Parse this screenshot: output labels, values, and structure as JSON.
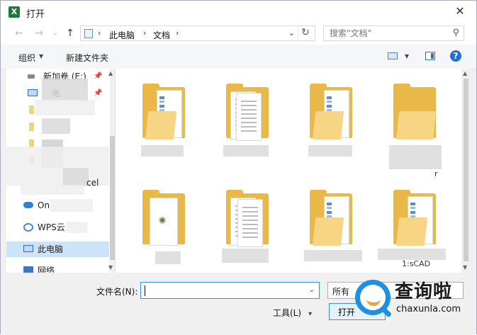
{
  "window": {
    "title": "打开",
    "app_icon_letter": "X",
    "close_glyph": "✕"
  },
  "nav": {
    "back_glyph": "←",
    "forward_glyph": "→",
    "dropdown_glyph": "⌄",
    "up_glyph": "↑"
  },
  "address": {
    "crumbs": [
      "此电脑",
      "文档"
    ],
    "separator": "›",
    "dropdown_glyph": "⌄",
    "refresh_glyph": "↻"
  },
  "search": {
    "placeholder": "搜索\"文档\"",
    "icon": "search-icon",
    "glyph": "⚲"
  },
  "toolbar": {
    "organize_label": "组织",
    "new_folder_label": "新建文件夹",
    "help_glyph": "?",
    "dropdown_glyph": "▾"
  },
  "sidebar": {
    "items": [
      {
        "label": "新加卷 (E:)",
        "icon": "drive-icon"
      },
      {
        "label": "电",
        "icon": "folder-icon"
      },
      {
        "label": "cel",
        "icon": "folder-icon"
      },
      {
        "label": "On",
        "icon": "onedrive-icon"
      },
      {
        "label": "WPS云",
        "icon": "wps-cloud-icon"
      },
      {
        "label": "此电脑",
        "icon": "pc-icon"
      },
      {
        "label": "网络",
        "icon": "network-icon"
      }
    ],
    "pin_glyph": "📌"
  },
  "content": {
    "partial_labels": [
      "r",
      "1:sCAD"
    ]
  },
  "filename": {
    "label": "文件名(N):",
    "value": ""
  },
  "filetype": {
    "label": "所有"
  },
  "tools": {
    "label": "工具(L)"
  },
  "open_button": {
    "label": "打开"
  },
  "watermark": {
    "brand": "查询啦",
    "site": "chaxunla.com"
  },
  "colors": {
    "accent": "#1f6fd0",
    "folder": "#e8b949",
    "selection": "#cce4f7"
  }
}
